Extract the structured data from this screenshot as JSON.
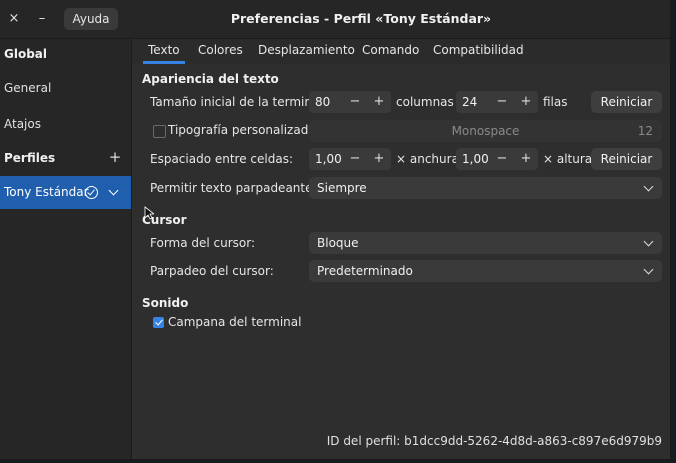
{
  "header": {
    "close_icon": "×",
    "minimize_icon": "–",
    "help_label": "Ayuda",
    "title": "Preferencias - Perfil «Tony Estándar»"
  },
  "sidebar": {
    "global_heading": "Global",
    "general_label": "General",
    "shortcuts_label": "Atajos",
    "profiles_heading": "Perfiles",
    "add_icon": "+",
    "selected_profile": "Tony Estándar"
  },
  "tabs": [
    "Texto",
    "Colores",
    "Desplazamiento",
    "Comando",
    "Compatibilidad"
  ],
  "active_tab": "Texto",
  "text_appearance": {
    "section": "Apariencia del texto",
    "size_label": "Tamaño inicial de la terminal:",
    "columns_value": "80",
    "columns_unit": "columnas",
    "rows_value": "24",
    "rows_unit": "filas",
    "reset_label": "Reiniciar",
    "custom_font_label": "Tipografía personalizada:",
    "custom_font_checked": false,
    "font_name": "Monospace",
    "font_size": "12",
    "spacing_label": "Espaciado entre celdas:",
    "width_value": "1,00",
    "width_unit": "× anchura",
    "height_value": "1,00",
    "height_unit": "× altura",
    "blink_label": "Permitir texto parpadeante:",
    "blink_value": "Siempre"
  },
  "cursor": {
    "section": "Cursor",
    "shape_label": "Forma del cursor:",
    "shape_value": "Bloque",
    "blink_label": "Parpadeo del cursor:",
    "blink_value": "Predeterminado"
  },
  "sound": {
    "section": "Sonido",
    "bell_label": "Campana del terminal",
    "bell_checked": true
  },
  "spin": {
    "minus": "−",
    "plus": "+"
  },
  "footer": {
    "profile_id": "ID del perfil:  b1dcc9dd-5262-4d8d-a863-c897e6d979b9"
  },
  "colors": {
    "accent": "#3584e4",
    "selection": "#1f5fae"
  }
}
